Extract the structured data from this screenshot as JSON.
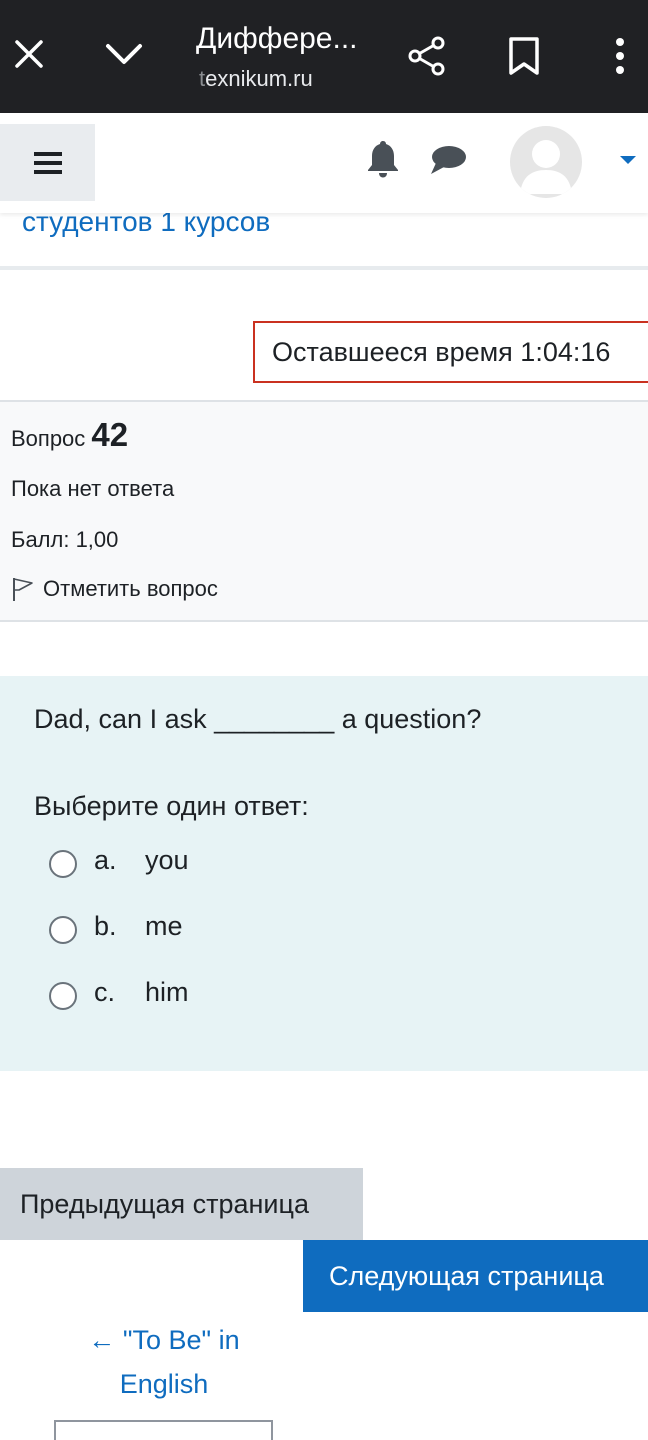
{
  "browser": {
    "title": "Диффере...",
    "url_dim": "t",
    "url_main": "exnikum.ru",
    "icons": [
      "close-icon",
      "chevron-down-icon",
      "share-icon",
      "bookmark-icon",
      "more-vert-icon"
    ]
  },
  "navbar": {
    "icons": [
      "hamburger-icon",
      "bell-icon",
      "chat-icon",
      "avatar",
      "caret-down-icon"
    ],
    "accent": "#0f6cbf"
  },
  "breadcrumb_tail": "студентов 1 курсов",
  "timer": {
    "text": "Оставшееся время 1:04:16",
    "border_color": "#ca3120"
  },
  "question_info": {
    "label": "Вопрос",
    "number": "42",
    "state": "Пока нет ответа",
    "grade": "Балл: 1,00",
    "flag_label": "Отметить вопрос"
  },
  "question": {
    "text": "Dad, can I ask ________ a question?",
    "prompt": "Выберите один ответ:",
    "options": [
      {
        "letter": "a.",
        "text": "you",
        "selected": false
      },
      {
        "letter": "b.",
        "text": "me",
        "selected": false
      },
      {
        "letter": "c.",
        "text": "him",
        "selected": false
      }
    ]
  },
  "navigation": {
    "prev_label": "Предыдущая страница",
    "next_label": "Следующая страница",
    "prev_activity_line1": "← \"To Be\" in",
    "prev_activity_line2": "English"
  }
}
